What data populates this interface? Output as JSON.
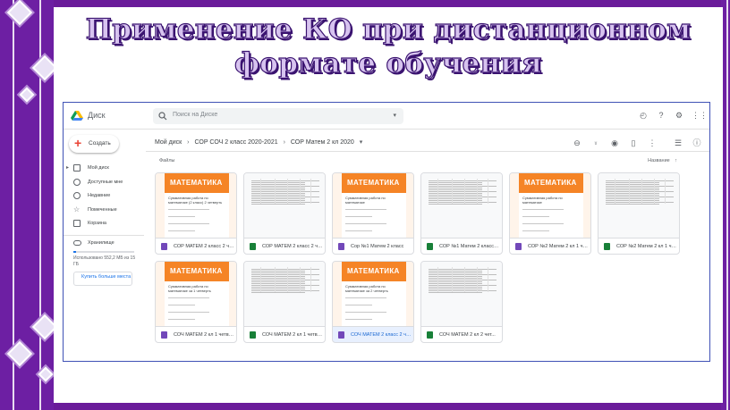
{
  "slide": {
    "title_line1": "Применение КО при дистанционном",
    "title_line2": "формате обучения",
    "colors": {
      "frame": "#6d1fa3",
      "title_fill": "#d7c3ef",
      "title_stroke": "#3a1370"
    }
  },
  "drive": {
    "app_name": "Диск",
    "search_placeholder": "Поиск на Диске",
    "top_icons": [
      "offline-status-icon",
      "help-icon",
      "settings-icon",
      "apps-grid-icon"
    ],
    "create_label": "Создать",
    "nav": [
      {
        "label": "Мой диск",
        "icon": "my-drive-icon"
      },
      {
        "label": "Доступные мне",
        "icon": "shared-icon"
      },
      {
        "label": "Недавние",
        "icon": "recent-icon"
      },
      {
        "label": "Помеченные",
        "icon": "star-icon"
      },
      {
        "label": "Корзина",
        "icon": "trash-icon"
      }
    ],
    "storage": {
      "label": "Хранилище",
      "used_text": "Использовано 552,2 МБ из 15 ГБ",
      "used_fraction": 0.037,
      "buy_label": "Купить больше места"
    },
    "breadcrumb": [
      "Мой диск",
      "СОР СОЧ 2 класс 2020-2021",
      "СОР Матем 2 кл 2020"
    ],
    "toolbar_icons": [
      "link-icon",
      "add-person-icon",
      "preview-icon",
      "delete-icon",
      "more-icon",
      "list-view-icon",
      "info-icon"
    ],
    "files_label": "Файлы",
    "sort_label": "Название",
    "form_thumb_header": "МАТЕМАТИКА",
    "files": [
      {
        "name": "СОР МАТЕМ 2 класс 2 чет...",
        "type": "form",
        "caption": "Суммативная работа по математике (2 класс) 2 четверть",
        "selected": false
      },
      {
        "name": "СОР МАТЕМ 2 класс 2 чет...",
        "type": "sheet",
        "selected": false
      },
      {
        "name": "Сор №1 Матем 2 класс",
        "type": "form",
        "caption": "Суммативная работа по математике",
        "selected": false
      },
      {
        "name": "СОР №1 Матем 2 класс (О...",
        "type": "sheet",
        "selected": false
      },
      {
        "name": "СОР №2 Матем 2 кл 1 чет...",
        "type": "form",
        "caption": "Суммативная работа по математике",
        "selected": false
      },
      {
        "name": "СОР №2 Матем 2 кл 1 чет...",
        "type": "sheet",
        "selected": false
      },
      {
        "name": "СОЧ МАТЕМ 2 кл 1 четвер...",
        "type": "form",
        "caption": "Суммативная работа по математике за 1 четверть",
        "selected": false
      },
      {
        "name": "СОЧ МАТЕМ 2 кл 1 четвер...",
        "type": "sheet",
        "selected": false
      },
      {
        "name": "СОЧ МАТЕМ 2 класс 2 чет...",
        "type": "form",
        "caption": "Суммативная работа по математике за 2 четверть",
        "selected": true
      },
      {
        "name": "СОЧ МАТЕМ 2 кл 2 чет...",
        "type": "sheet",
        "selected": false
      }
    ]
  }
}
